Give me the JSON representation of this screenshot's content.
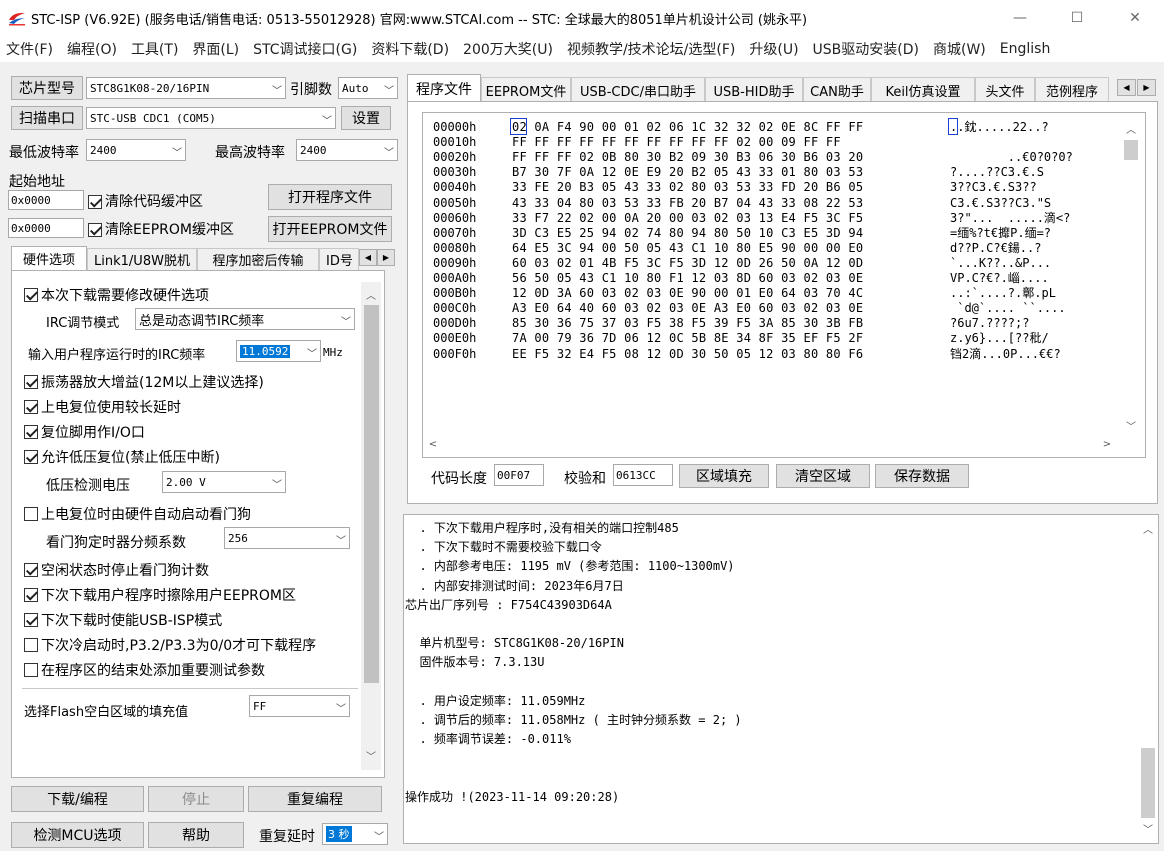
{
  "window": {
    "title": "STC-ISP (V6.92E) (服务电话/销售电话: 0513-55012928) 官网:www.STCAI.com  -- STC: 全球最大的8051单片机设计公司 (姚永平)",
    "minimize": "—",
    "maximize": "☐",
    "close": "✕"
  },
  "menu": [
    "文件(F)",
    "编程(O)",
    "工具(T)",
    "界面(L)",
    "STC调试接口(G)",
    "资料下载(D)",
    "200万大奖(U)",
    "视频教学/技术论坛/选型(F)",
    "升级(U)",
    "USB驱动安装(D)",
    "商城(W)",
    "English"
  ],
  "left": {
    "chip_type_btn": "芯片型号",
    "chip_type_value": "STC8G1K08-20/16PIN",
    "pin_label": "引脚数",
    "pin_value": "Auto",
    "scan_port_btn": "扫描串口",
    "port_value": "STC-USB CDC1 (COM5)",
    "settings_btn": "设置",
    "min_baud_label": "最低波特率",
    "min_baud_value": "2400",
    "max_baud_label": "最高波特率",
    "max_baud_value": "2400",
    "start_addr_label": "起始地址",
    "addr1": "0x0000",
    "clear_code_label": "清除代码缓冲区",
    "open_prog_btn": "打开程序文件",
    "addr2": "0x0000",
    "clear_eeprom_label": "清除EEPROM缓冲区",
    "open_eeprom_btn": "打开EEPROM文件",
    "tabs": [
      "硬件选项",
      "Link1/U8W脱机",
      "程序加密后传输",
      "ID号"
    ],
    "options": {
      "modify_hw": "本次下载需要修改硬件选项",
      "irc_mode_label": "IRC调节模式",
      "irc_mode_value": "总是动态调节IRC频率",
      "irc_freq_label": "输入用户程序运行时的IRC频率",
      "irc_freq_value": "11.0592",
      "irc_freq_unit": "MHz",
      "osc_gain": "振荡器放大增益(12M以上建议选择)",
      "long_delay": "上电复位使用较长延时",
      "reset_pin_io": "复位脚用作I/O口",
      "lvd_reset": "允许低压复位(禁止低压中断)",
      "lvd_label": "低压检测电压",
      "lvd_value": "2.00 V",
      "wdt_auto": "上电复位时由硬件自动启动看门狗",
      "wdt_div_label": "看门狗定时器分频系数",
      "wdt_div_value": "256",
      "idle_wdt_stop": "空闲状态时停止看门狗计数",
      "erase_eeprom": "下次下载用户程序时擦除用户EEPROM区",
      "usb_isp": "下次下载时使能USB-ISP模式",
      "cold_boot": "下次冷启动时,P3.2/P3.3为0/0才可下载程序",
      "add_test_params": "在程序区的结束处添加重要测试参数",
      "fill_label": "选择Flash空白区域的填充值",
      "fill_value": "FF"
    },
    "download_btn": "下载/编程",
    "stop_btn": "停止",
    "reprogram_btn": "重复编程",
    "detect_mcu_btn": "检测MCU选项",
    "help_btn": "帮助",
    "repeat_delay_label": "重复延时",
    "repeat_delay_value": "3 秒"
  },
  "right": {
    "tabs": [
      "程序文件",
      "EEPROM文件",
      "USB-CDC/串口助手",
      "USB-HID助手",
      "CAN助手",
      "Keil仿真设置",
      "头文件",
      "范例程序"
    ],
    "hex_rows": [
      {
        "addr": "00000h",
        "bytes": "02 0A F4 90 00 01 02 06 1C 32 32 02 0E 8C FF FF",
        "ascii": "..鈂.....22..?"
      },
      {
        "addr": "00010h",
        "bytes": "FF FF FF FF FF FF FF FF FF FF 02 00 09 FF FF",
        "ascii": ""
      },
      {
        "addr": "00020h",
        "bytes": "FF FF FF 02 0B 80 30 B2 09 30 B3 06 30 B6 03 20",
        "ascii": "        ..€0?0?0?"
      },
      {
        "addr": "00030h",
        "bytes": "B7 30 7F 0A 12 0E E9 20 B2 05 43 33 01 80 03 53",
        "ascii": "?....??C3.€.S"
      },
      {
        "addr": "00040h",
        "bytes": "33 FE 20 B3 05 43 33 02 80 03 53 33 FD 20 B6 05",
        "ascii": "3??C3.€.S3??"
      },
      {
        "addr": "00050h",
        "bytes": "43 33 04 80 03 53 33 FB 20 B7 04 43 33 08 22 53",
        "ascii": "C3.€.S3??C3.\"S"
      },
      {
        "addr": "00060h",
        "bytes": "33 F7 22 02 00 0A 20 00 03 02 03 13 E4 F5 3C F5",
        "ascii": "3?\"...  .....滴<?"
      },
      {
        "addr": "00070h",
        "bytes": "3D C3 E5 25 94 02 74 80 94 80 50 10 C3 E5 3D 94",
        "ascii": "=缅%?t€攠P.缅=?"
      },
      {
        "addr": "00080h",
        "bytes": "64 E5 3C 94 00 50 05 43 C1 10 80 E5 90 00 00 E0",
        "ascii": "d??P.C?€鍚..?"
      },
      {
        "addr": "00090h",
        "bytes": "60 03 02 01 4B F5 3C F5 3D 12 0D 26 50 0A 12 0D",
        "ascii": "`...K??..&P..."
      },
      {
        "addr": "000A0h",
        "bytes": "56 50 05 43 C1 10 80 F1 12 03 8D 60 03 02 03 0E",
        "ascii": "VP.C?€?.崰...."
      },
      {
        "addr": "000B0h",
        "bytes": "12 0D 3A 60 03 02 03 0E 90 00 01 E0 64 03 70 4C",
        "ascii": "..:`....?.鄣.pL"
      },
      {
        "addr": "000C0h",
        "bytes": "A3 E0 64 40 60 03 02 03 0E A3 E0 60 03 02 03 0E",
        "ascii": " `d@`.... ``...."
      },
      {
        "addr": "000D0h",
        "bytes": "85 30 36 75 37 03 F5 38 F5 39 F5 3A 85 30 3B FB",
        "ascii": "?6u7.????;?"
      },
      {
        "addr": "000E0h",
        "bytes": "7A 00 79 36 7D 06 12 0C 5B 8E 34 8F 35 EF F5 2F",
        "ascii": "z.y6}...[??秕/"
      },
      {
        "addr": "000F0h",
        "bytes": "EE F5 32 E4 F5 08 12 0D 30 50 05 12 03 80 80 F6",
        "ascii": "铛2滴...0P...€€?"
      }
    ],
    "code_len_label": "代码长度",
    "code_len_value": "00F07",
    "checksum_label": "校验和",
    "checksum_value": "0613CC",
    "fill_area_btn": "区域填充",
    "clear_area_btn": "清空区域",
    "save_data_btn": "保存数据",
    "log": [
      "  . 下次下载用户程序时,没有相关的端口控制485",
      "  . 下次下载时不需要校验下载口令",
      "  . 内部参考电压: 1195 mV (参考范围: 1100~1300mV)",
      "  . 内部安排测试时间: 2023年6月7日",
      "芯片出厂序列号 : F754C43903D64A",
      "",
      "  单片机型号: STC8G1K08-20/16PIN",
      "  固件版本号: 7.3.13U",
      "",
      "  . 用户设定频率: 11.059MHz",
      "  . 调节后的频率: 11.058MHz ( 主时钟分频系数 = 2; )",
      "  . 频率调节误差: -0.011%",
      "",
      "",
      "操作成功 !(2023-11-14 09:20:28)"
    ]
  }
}
